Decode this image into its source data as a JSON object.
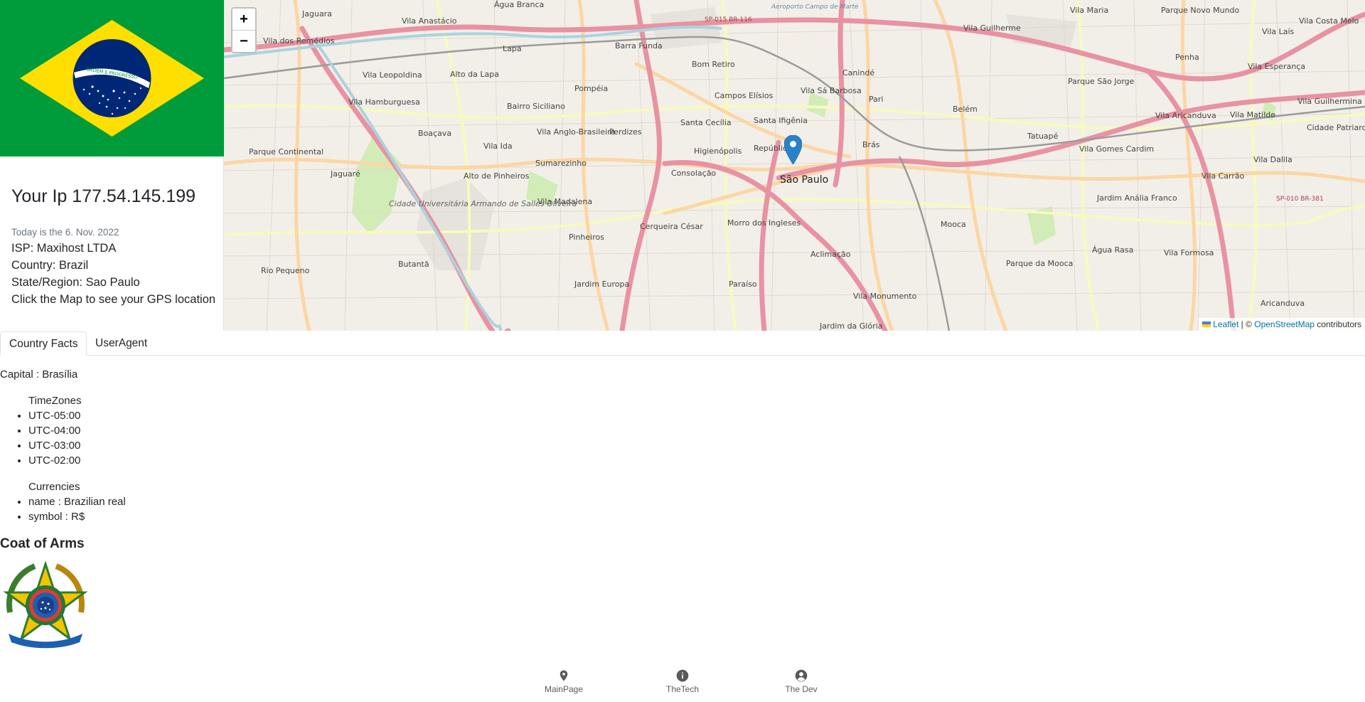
{
  "info": {
    "ip_label": "Your Ip 177.54.145.199",
    "date": "Today is the 6. Nov. 2022",
    "isp": "ISP: Maxihost LTDA",
    "country": "Country: Brazil",
    "region": "State/Region: Sao Paulo",
    "hint": "Click the Map to see your GPS location",
    "flag_motto": "ORDEM E PROGRESSO"
  },
  "map": {
    "zoom_in": "+",
    "zoom_out": "−",
    "center_label": "São Paulo",
    "attribution": {
      "leaflet": "Leaflet",
      "separator": " | © ",
      "osm": "OpenStreetMap",
      "suffix": " contributors"
    },
    "places": [
      "Jaguara",
      "Vila Anastácio",
      "Água Branca",
      "Vila dos Remédios",
      "Lapa",
      "Barra Funda",
      "Vila Leopoldina",
      "Alto da Lapa",
      "Pompéia",
      "Bom Retiro",
      "Vila Sá Barbosa",
      "Pari",
      "Canindé",
      "Vila Guilherme",
      "Vila Maria",
      "Parque Novo Mundo",
      "Vila Hamburguesa",
      "Bairro Siciliano",
      "Campos Elísios",
      "Santa Cecília",
      "Santa Ifigênia",
      "Perdizes",
      "Boaçava",
      "Vila Ida",
      "Vila Anglo-Brasileira",
      "República",
      "Brás",
      "Belém",
      "Tatuapé",
      "Parque São Jorge",
      "Vila Aricanduva",
      "Vila Matilde",
      "Vila Guilhermina",
      "Penha",
      "Vila Esperança",
      "Vila Laís",
      "Vila Costa Melo",
      "Parque Continental",
      "Jaguaré",
      "Alto de Pinheiros",
      "Sumarezinho",
      "Higienópolis",
      "Consolação",
      "Vila Gomes Cardim",
      "Vila Carrão",
      "Vila Dalila",
      "Cidade Patriarca",
      "Vila Madalena",
      "Cerqueira César",
      "Morro dos Ingleses",
      "Mooca",
      "Jardim Anália Franco",
      "Cidade Universitária Armando de Salles Oliveira",
      "Butantã",
      "Pinheiros",
      "Aclimação",
      "Parque da Mooca",
      "Água Rasa",
      "Vila Formosa",
      "Rio Pequeno",
      "Jardim Europa",
      "Paraíso",
      "Vila Monumento",
      "Jardim da Glória",
      "Aricanduva",
      "Aeroporto Campo de Marte",
      "SP-015 BR-116",
      "SP-010 BR-381"
    ]
  },
  "tabs": {
    "country_facts": "Country Facts",
    "user_agent": "UserAgent"
  },
  "facts": {
    "capital": "Capital : Brasília",
    "timezones_title": "TimeZones",
    "timezones": [
      "UTC-05:00",
      "UTC-04:00",
      "UTC-03:00",
      "UTC-02:00"
    ],
    "currencies_title": "Currencies",
    "currencies": [
      "name : Brazilian real",
      "symbol : R$"
    ],
    "coat_title": "Coat of Arms"
  },
  "nav": {
    "main": "MainPage",
    "tech": "TheTech",
    "dev": "The Dev"
  },
  "colors": {
    "flag_green": "#009c3b",
    "flag_yellow": "#ffdf00",
    "flag_blue": "#002776",
    "map_bg": "#f2efe9",
    "road_major": "#e892a2",
    "road_secondary": "#fcd6a4",
    "road_tertiary": "#f7fabf",
    "marker_blue": "#2a81cb",
    "link": "#0078a8"
  }
}
